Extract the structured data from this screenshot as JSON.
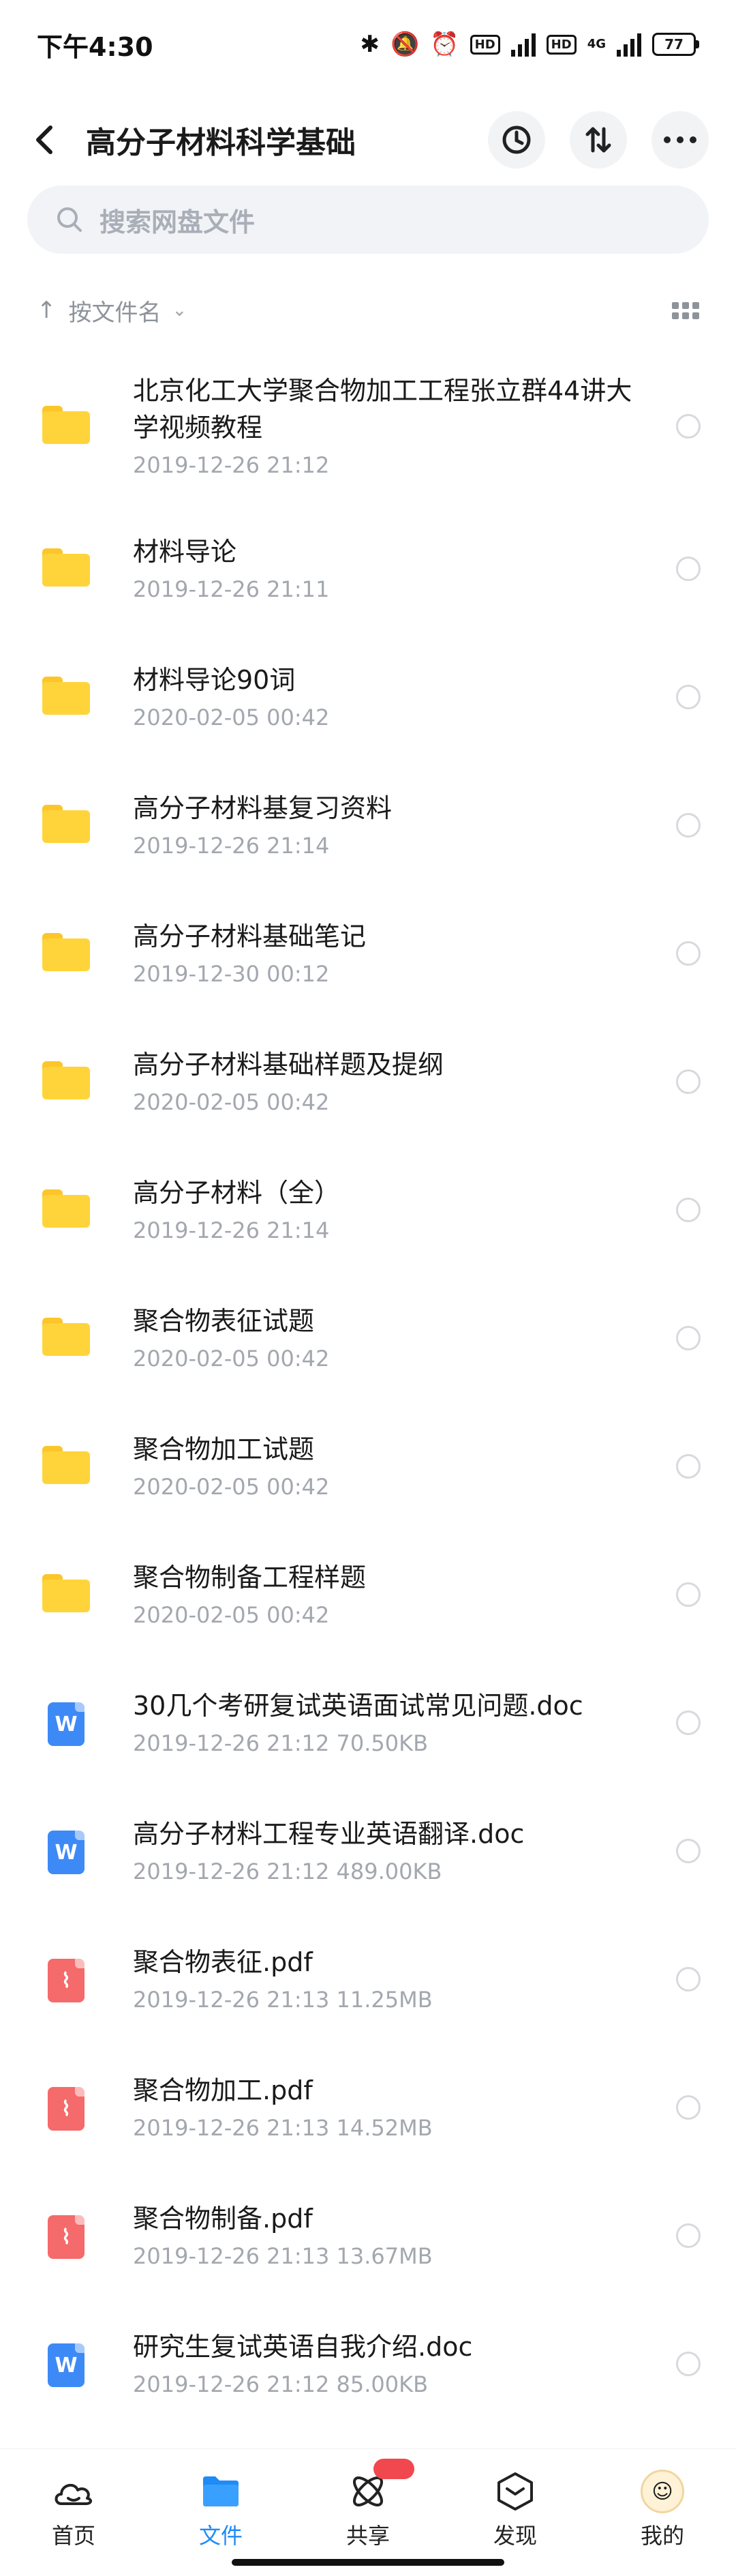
{
  "status_bar": {
    "time": "下午4:30",
    "battery": "77",
    "hd": "HD",
    "net": "4G"
  },
  "header": {
    "title": "高分子材料科学基础"
  },
  "search": {
    "placeholder": "搜索网盘文件"
  },
  "sort": {
    "label": "按文件名"
  },
  "files": [
    {
      "type": "folder",
      "name": "北京化工大学聚合物加工工程张立群44讲大学视频教程",
      "meta": "2019-12-26  21:12"
    },
    {
      "type": "folder",
      "name": "材料导论",
      "meta": "2019-12-26  21:11"
    },
    {
      "type": "folder",
      "name": "材料导论90词",
      "meta": "2020-02-05  00:42"
    },
    {
      "type": "folder",
      "name": "高分子材料基复习资料",
      "meta": "2019-12-26  21:14"
    },
    {
      "type": "folder",
      "name": "高分子材料基础笔记",
      "meta": "2019-12-30  00:12"
    },
    {
      "type": "folder",
      "name": "高分子材料基础样题及提纲",
      "meta": "2020-02-05  00:42"
    },
    {
      "type": "folder",
      "name": "高分子材料（全）",
      "meta": "2019-12-26  21:14"
    },
    {
      "type": "folder",
      "name": "聚合物表征试题",
      "meta": "2020-02-05  00:42"
    },
    {
      "type": "folder",
      "name": "聚合物加工试题",
      "meta": "2020-02-05  00:42"
    },
    {
      "type": "folder",
      "name": "聚合物制备工程样题",
      "meta": "2020-02-05  00:42"
    },
    {
      "type": "word",
      "name": "30几个考研复试英语面试常见问题.doc",
      "meta": "2019-12-26  21:12   70.50KB"
    },
    {
      "type": "word",
      "name": "高分子材料工程专业英语翻译.doc",
      "meta": "2019-12-26  21:12   489.00KB"
    },
    {
      "type": "pdf",
      "name": "聚合物表征.pdf",
      "meta": "2019-12-26  21:13   11.25MB"
    },
    {
      "type": "pdf",
      "name": "聚合物加工.pdf",
      "meta": "2019-12-26  21:13   14.52MB"
    },
    {
      "type": "pdf",
      "name": "聚合物制备.pdf",
      "meta": "2019-12-26  21:13   13.67MB"
    },
    {
      "type": "word",
      "name": "研究生复试英语自我介绍.doc",
      "meta": "2019-12-26  21:12   85.00KB"
    }
  ],
  "nav": [
    {
      "key": "home",
      "label": "首页"
    },
    {
      "key": "files",
      "label": "文件"
    },
    {
      "key": "share",
      "label": "共享"
    },
    {
      "key": "discover",
      "label": "发现"
    },
    {
      "key": "me",
      "label": "我的"
    }
  ],
  "colors": {
    "accent": "#1e8bf7",
    "folder": "#ffd43a",
    "word": "#3d8af7",
    "pdf": "#f56a6a",
    "badge": "#f0484e"
  }
}
